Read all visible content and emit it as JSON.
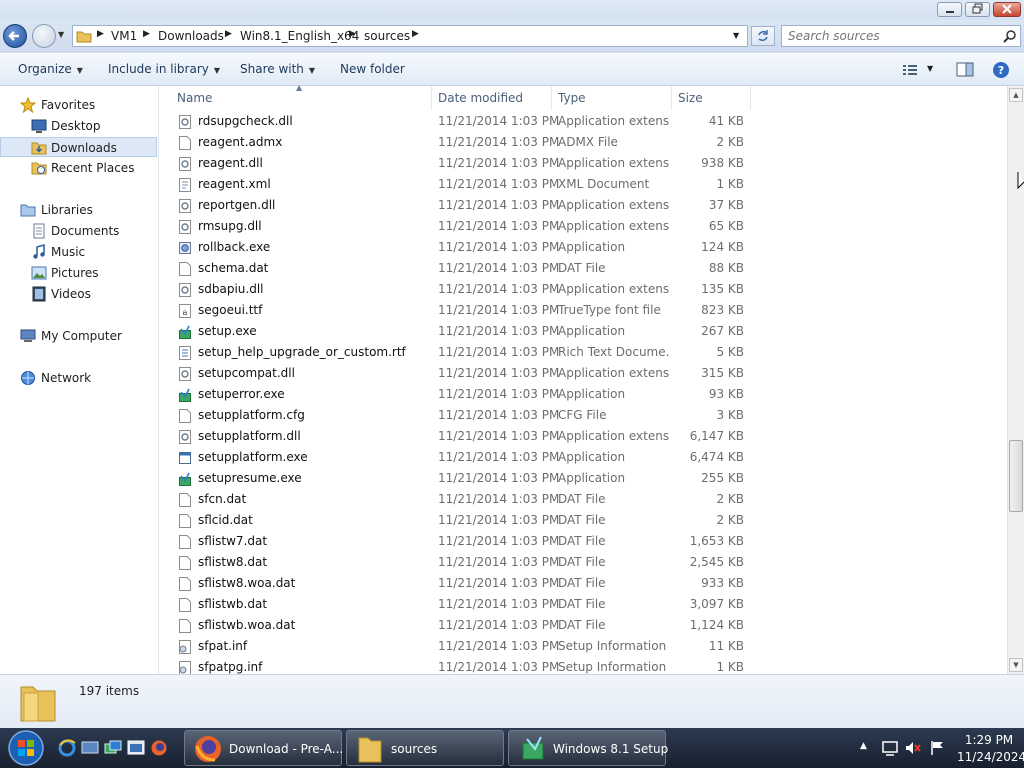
{
  "address_bar": {
    "breadcrumbs": [
      "VM1",
      "Downloads",
      "Win8.1_English_x64",
      "sources"
    ]
  },
  "search": {
    "placeholder": "Search sources"
  },
  "toolbar": {
    "organize": "Organize",
    "include_in_library": "Include in library",
    "share_with": "Share with",
    "new_folder": "New folder"
  },
  "sidebar": {
    "favorites": "Favorites",
    "desktop": "Desktop",
    "downloads": "Downloads",
    "recent_places": "Recent Places",
    "libraries": "Libraries",
    "documents": "Documents",
    "music": "Music",
    "pictures": "Pictures",
    "videos": "Videos",
    "my_computer": "My Computer",
    "network": "Network"
  },
  "columns": {
    "name": "Name",
    "date_modified": "Date modified",
    "type": "Type",
    "size": "Size"
  },
  "files": [
    {
      "name": "rdsupgcheck.dll",
      "date": "11/21/2014 1:03 PM",
      "type": "Application extens...",
      "size": "41 KB",
      "icon": "dll-icon"
    },
    {
      "name": "reagent.admx",
      "date": "11/21/2014 1:03 PM",
      "type": "ADMX File",
      "size": "2 KB",
      "icon": "file-icon"
    },
    {
      "name": "reagent.dll",
      "date": "11/21/2014 1:03 PM",
      "type": "Application extens...",
      "size": "938 KB",
      "icon": "dll-icon"
    },
    {
      "name": "reagent.xml",
      "date": "11/21/2014 1:03 PM",
      "type": "XML Document",
      "size": "1 KB",
      "icon": "xml-icon"
    },
    {
      "name": "reportgen.dll",
      "date": "11/21/2014 1:03 PM",
      "type": "Application extens...",
      "size": "37 KB",
      "icon": "dll-icon"
    },
    {
      "name": "rmsupg.dll",
      "date": "11/21/2014 1:03 PM",
      "type": "Application extens...",
      "size": "65 KB",
      "icon": "dll-icon"
    },
    {
      "name": "rollback.exe",
      "date": "11/21/2014 1:03 PM",
      "type": "Application",
      "size": "124 KB",
      "icon": "exe-icon"
    },
    {
      "name": "schema.dat",
      "date": "11/21/2014 1:03 PM",
      "type": "DAT File",
      "size": "88 KB",
      "icon": "file-icon"
    },
    {
      "name": "sdbapiu.dll",
      "date": "11/21/2014 1:03 PM",
      "type": "Application extens...",
      "size": "135 KB",
      "icon": "dll-icon"
    },
    {
      "name": "segoeui.ttf",
      "date": "11/21/2014 1:03 PM",
      "type": "TrueType font file",
      "size": "823 KB",
      "icon": "font-icon"
    },
    {
      "name": "setup.exe",
      "date": "11/21/2014 1:03 PM",
      "type": "Application",
      "size": "267 KB",
      "icon": "setup-exe-icon"
    },
    {
      "name": "setup_help_upgrade_or_custom.rtf",
      "date": "11/21/2014 1:03 PM",
      "type": "Rich Text Docume...",
      "size": "5 KB",
      "icon": "rtf-icon"
    },
    {
      "name": "setupcompat.dll",
      "date": "11/21/2014 1:03 PM",
      "type": "Application extens...",
      "size": "315 KB",
      "icon": "dll-icon"
    },
    {
      "name": "setuperror.exe",
      "date": "11/21/2014 1:03 PM",
      "type": "Application",
      "size": "93 KB",
      "icon": "setup-exe-icon"
    },
    {
      "name": "setupplatform.cfg",
      "date": "11/21/2014 1:03 PM",
      "type": "CFG File",
      "size": "3 KB",
      "icon": "file-icon"
    },
    {
      "name": "setupplatform.dll",
      "date": "11/21/2014 1:03 PM",
      "type": "Application extens...",
      "size": "6,147 KB",
      "icon": "dll-icon"
    },
    {
      "name": "setupplatform.exe",
      "date": "11/21/2014 1:03 PM",
      "type": "Application",
      "size": "6,474 KB",
      "icon": "window-exe-icon"
    },
    {
      "name": "setupresume.exe",
      "date": "11/21/2014 1:03 PM",
      "type": "Application",
      "size": "255 KB",
      "icon": "setup-exe-icon"
    },
    {
      "name": "sfcn.dat",
      "date": "11/21/2014 1:03 PM",
      "type": "DAT File",
      "size": "2 KB",
      "icon": "file-icon"
    },
    {
      "name": "sflcid.dat",
      "date": "11/21/2014 1:03 PM",
      "type": "DAT File",
      "size": "2 KB",
      "icon": "file-icon"
    },
    {
      "name": "sflistw7.dat",
      "date": "11/21/2014 1:03 PM",
      "type": "DAT File",
      "size": "1,653 KB",
      "icon": "file-icon"
    },
    {
      "name": "sflistw8.dat",
      "date": "11/21/2014 1:03 PM",
      "type": "DAT File",
      "size": "2,545 KB",
      "icon": "file-icon"
    },
    {
      "name": "sflistw8.woa.dat",
      "date": "11/21/2014 1:03 PM",
      "type": "DAT File",
      "size": "933 KB",
      "icon": "file-icon"
    },
    {
      "name": "sflistwb.dat",
      "date": "11/21/2014 1:03 PM",
      "type": "DAT File",
      "size": "3,097 KB",
      "icon": "file-icon"
    },
    {
      "name": "sflistwb.woa.dat",
      "date": "11/21/2014 1:03 PM",
      "type": "DAT File",
      "size": "1,124 KB",
      "icon": "file-icon"
    },
    {
      "name": "sfpat.inf",
      "date": "11/21/2014 1:03 PM",
      "type": "Setup Information",
      "size": "11 KB",
      "icon": "inf-icon"
    },
    {
      "name": "sfpatpg.inf",
      "date": "11/21/2014 1:03 PM",
      "type": "Setup Information",
      "size": "1 KB",
      "icon": "inf-icon"
    }
  ],
  "status": {
    "item_count": "197 items"
  },
  "taskbar": {
    "tasks": [
      "Download - Pre-A...",
      "sources",
      "Windows 8.1 Setup"
    ],
    "time": "1:29 PM",
    "date": "11/24/2024"
  },
  "colors": {
    "accent": "#1e395b",
    "selection": "#dce8f5",
    "taskbar": "#1f2a3c"
  }
}
